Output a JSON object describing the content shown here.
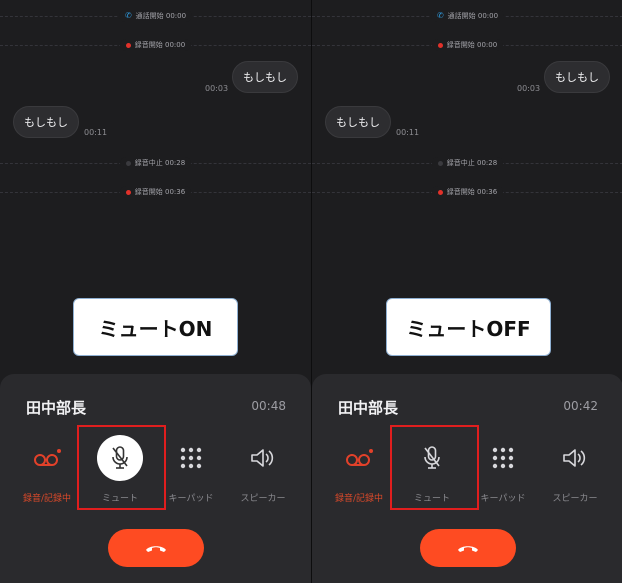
{
  "panels": [
    {
      "events": [
        {
          "kind": "call",
          "label": "通話開始 00:00"
        },
        {
          "kind": "rec",
          "label": "録音開始 00:00"
        },
        {
          "kind": "stop",
          "label": "録音中止 00:28"
        },
        {
          "kind": "rec",
          "label": "録音開始 00:36"
        }
      ],
      "messages": [
        {
          "text": "もしもし",
          "time": "00:03"
        },
        {
          "text": "もしもし",
          "time": "00:11"
        }
      ],
      "callout": "ミュートON",
      "callee": "田中部長",
      "timer": "00:48",
      "controls": {
        "record": "録音/記録中",
        "mute": "ミュート",
        "keypad": "キーパッド",
        "speaker": "スピーカー"
      },
      "mute_active": true
    },
    {
      "events": [
        {
          "kind": "call",
          "label": "通話開始 00:00"
        },
        {
          "kind": "rec",
          "label": "録音開始 00:00"
        },
        {
          "kind": "stop",
          "label": "録音中止 00:28"
        },
        {
          "kind": "rec",
          "label": "録音開始 00:36"
        }
      ],
      "messages": [
        {
          "text": "もしもし",
          "time": "00:03"
        },
        {
          "text": "もしもし",
          "time": "00:11"
        }
      ],
      "callout": "ミュートOFF",
      "callee": "田中部長",
      "timer": "00:42",
      "controls": {
        "record": "録音/記録中",
        "mute": "ミュート",
        "keypad": "キーパッド",
        "speaker": "スピーカー"
      },
      "mute_active": false
    }
  ],
  "colors": {
    "accent": "#fe4b22",
    "record_red": "#e2312a",
    "highlight_red": "#e01e1e",
    "background": "#1d1d1f",
    "sheet": "#2a2a2d"
  },
  "icons": [
    "phone-icon",
    "record-dot-icon",
    "voicemail-icon",
    "microphone-muted-icon",
    "keypad-icon",
    "speaker-icon",
    "hang-up-icon"
  ]
}
